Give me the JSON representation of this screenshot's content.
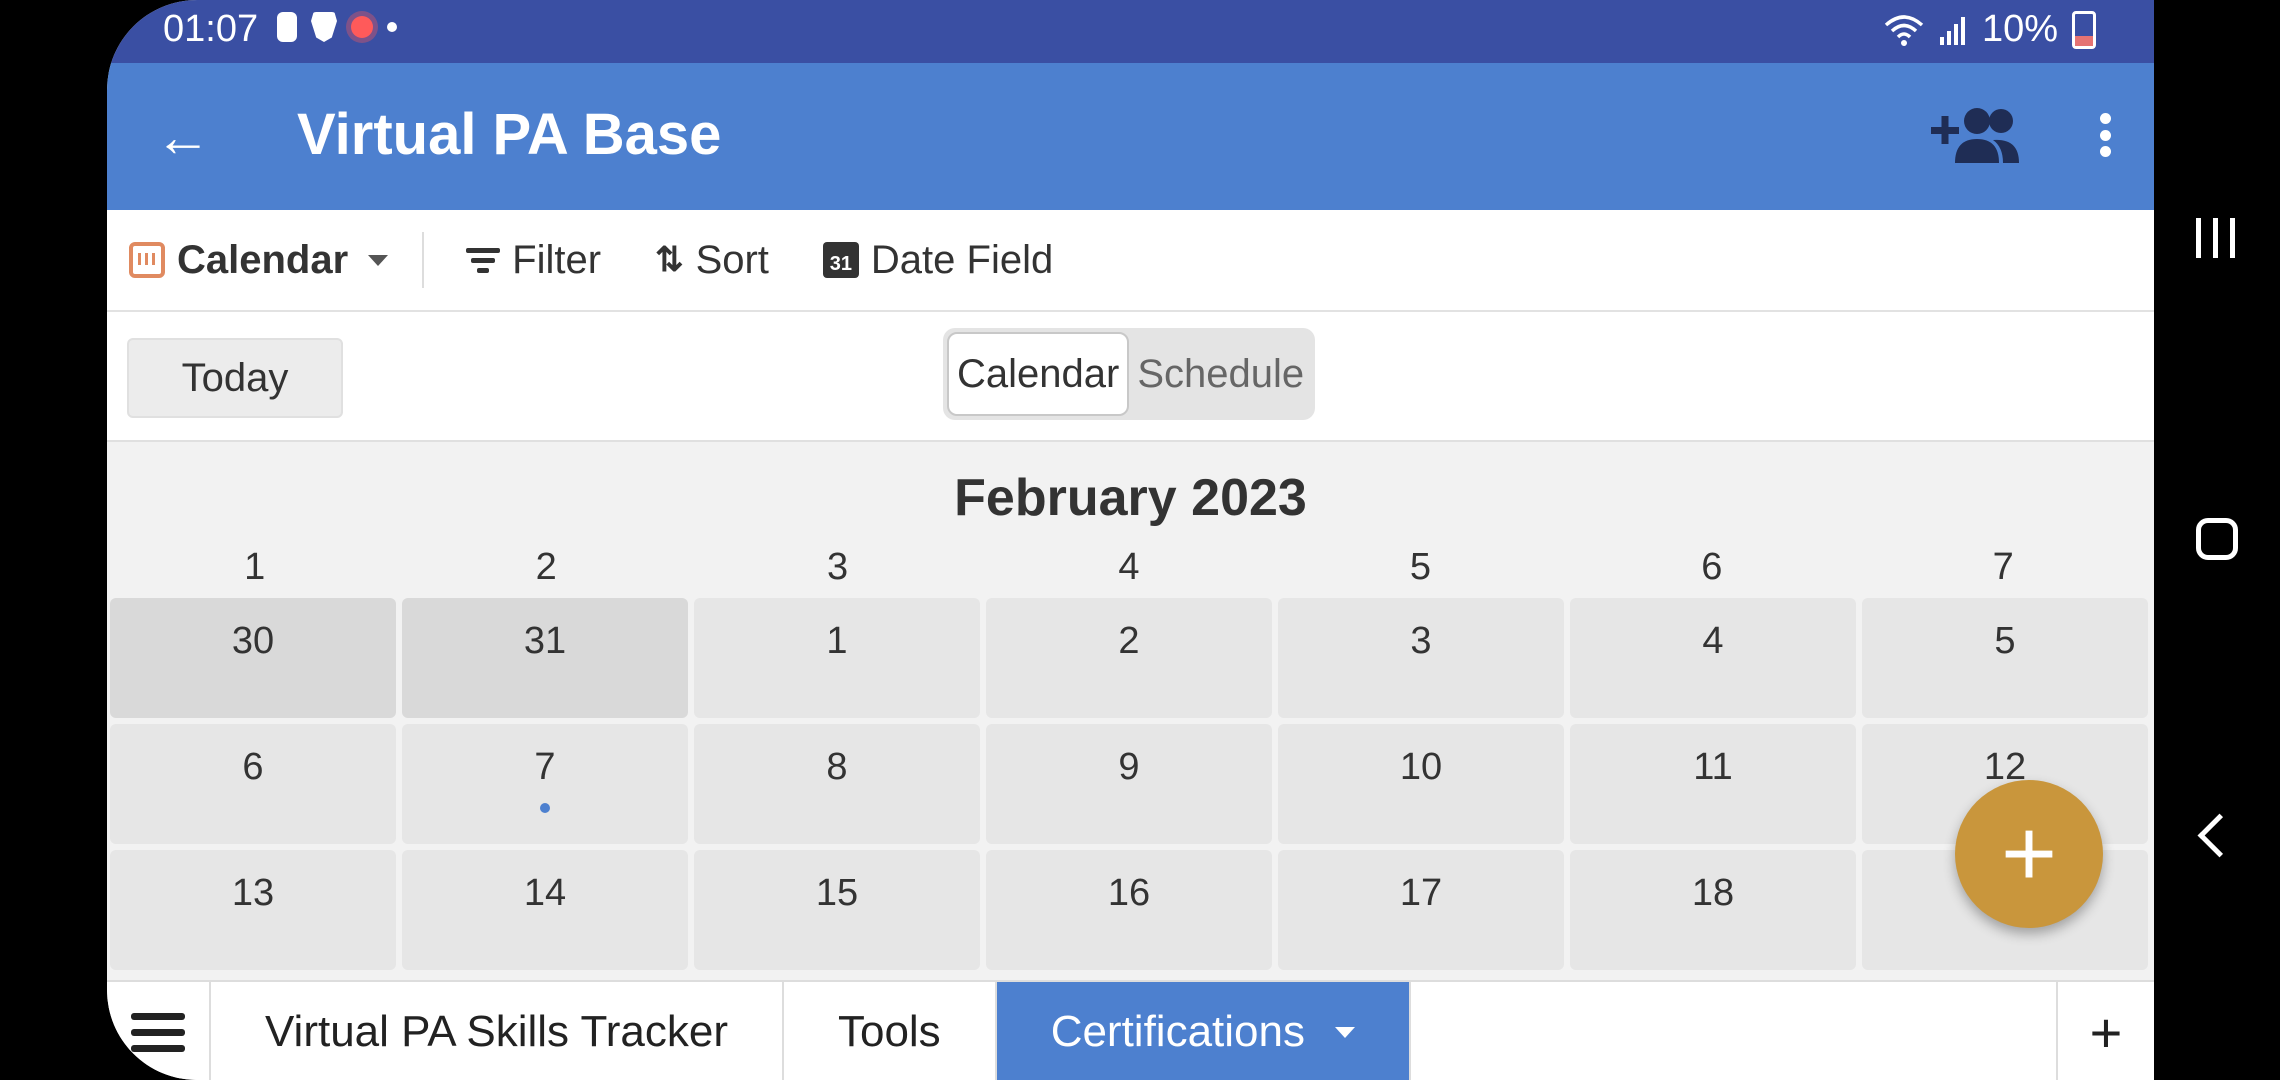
{
  "status": {
    "time": "01:07",
    "battery": "10%"
  },
  "appbar": {
    "title": "Virtual PA Base"
  },
  "toolbar": {
    "view_label": "Calendar",
    "filter_label": "Filter",
    "sort_label": "Sort",
    "date_field_label": "Date Field",
    "date_icon_text": "31"
  },
  "controls": {
    "today_label": "Today",
    "segments": [
      "Calendar",
      "Schedule"
    ],
    "active_segment": "Calendar"
  },
  "calendar": {
    "month_title": "February 2023",
    "week_headers": [
      "1",
      "2",
      "3",
      "4",
      "5",
      "6",
      "7"
    ],
    "rows": [
      [
        "30",
        "31",
        "1",
        "2",
        "3",
        "4",
        "5"
      ],
      [
        "6",
        "7",
        "8",
        "9",
        "10",
        "11",
        "12"
      ],
      [
        "13",
        "14",
        "15",
        "16",
        "17",
        "18",
        ""
      ]
    ],
    "other_month_days": [
      "30",
      "31"
    ],
    "event_days": [
      "7"
    ]
  },
  "fab": {
    "label": "+"
  },
  "tabs": [
    {
      "label": "Virtual PA Skills Tracker",
      "active": false
    },
    {
      "label": "Tools",
      "active": false
    },
    {
      "label": "Certifications",
      "active": true
    }
  ],
  "tab_add_label": "+",
  "colors": {
    "status_bar": "#3a4fa3",
    "app_bar": "#4d80cf",
    "fab": "#c9963c",
    "calendar_icon": "#e08a60",
    "event_dot": "#4d80cf"
  }
}
